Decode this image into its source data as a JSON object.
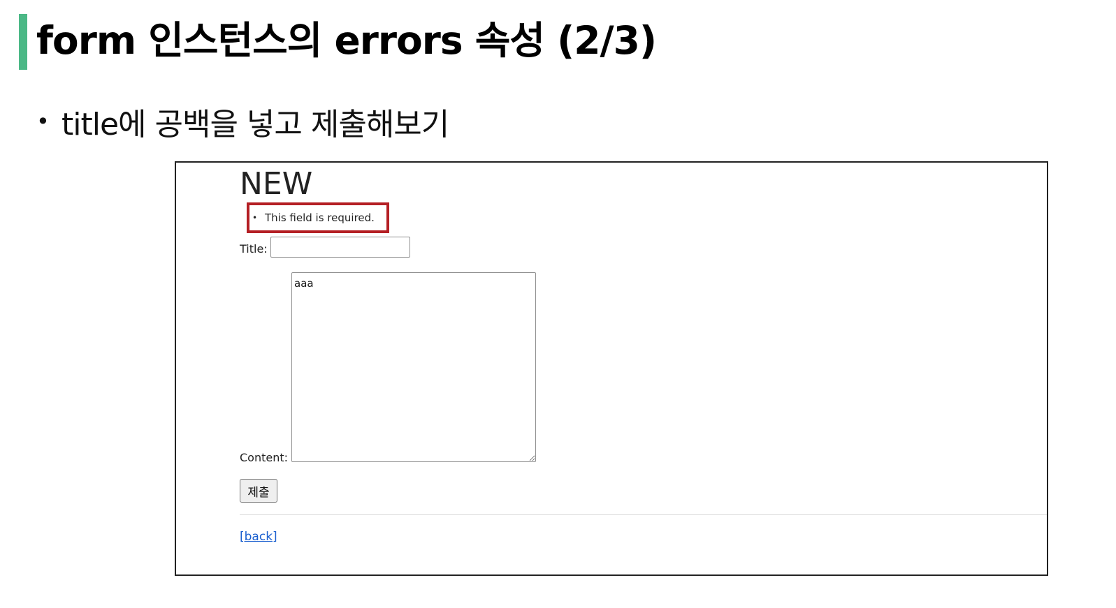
{
  "slide": {
    "title": "form 인스턴스의 errors 속성 (2/3)",
    "accent_color": "#4bb886",
    "bullet_char": "•",
    "bullet_text": "title에 공백을 넣고 제출해보기"
  },
  "browser": {
    "heading": "NEW",
    "errors": {
      "bullet_char": "•",
      "message": "This field is required.",
      "highlight_color": "#b41f24"
    },
    "form": {
      "title_label": "Title:",
      "title_value": "",
      "content_label": "Content:",
      "content_value": "aaa",
      "submit_label": "제출"
    },
    "back_link": "[back]"
  }
}
